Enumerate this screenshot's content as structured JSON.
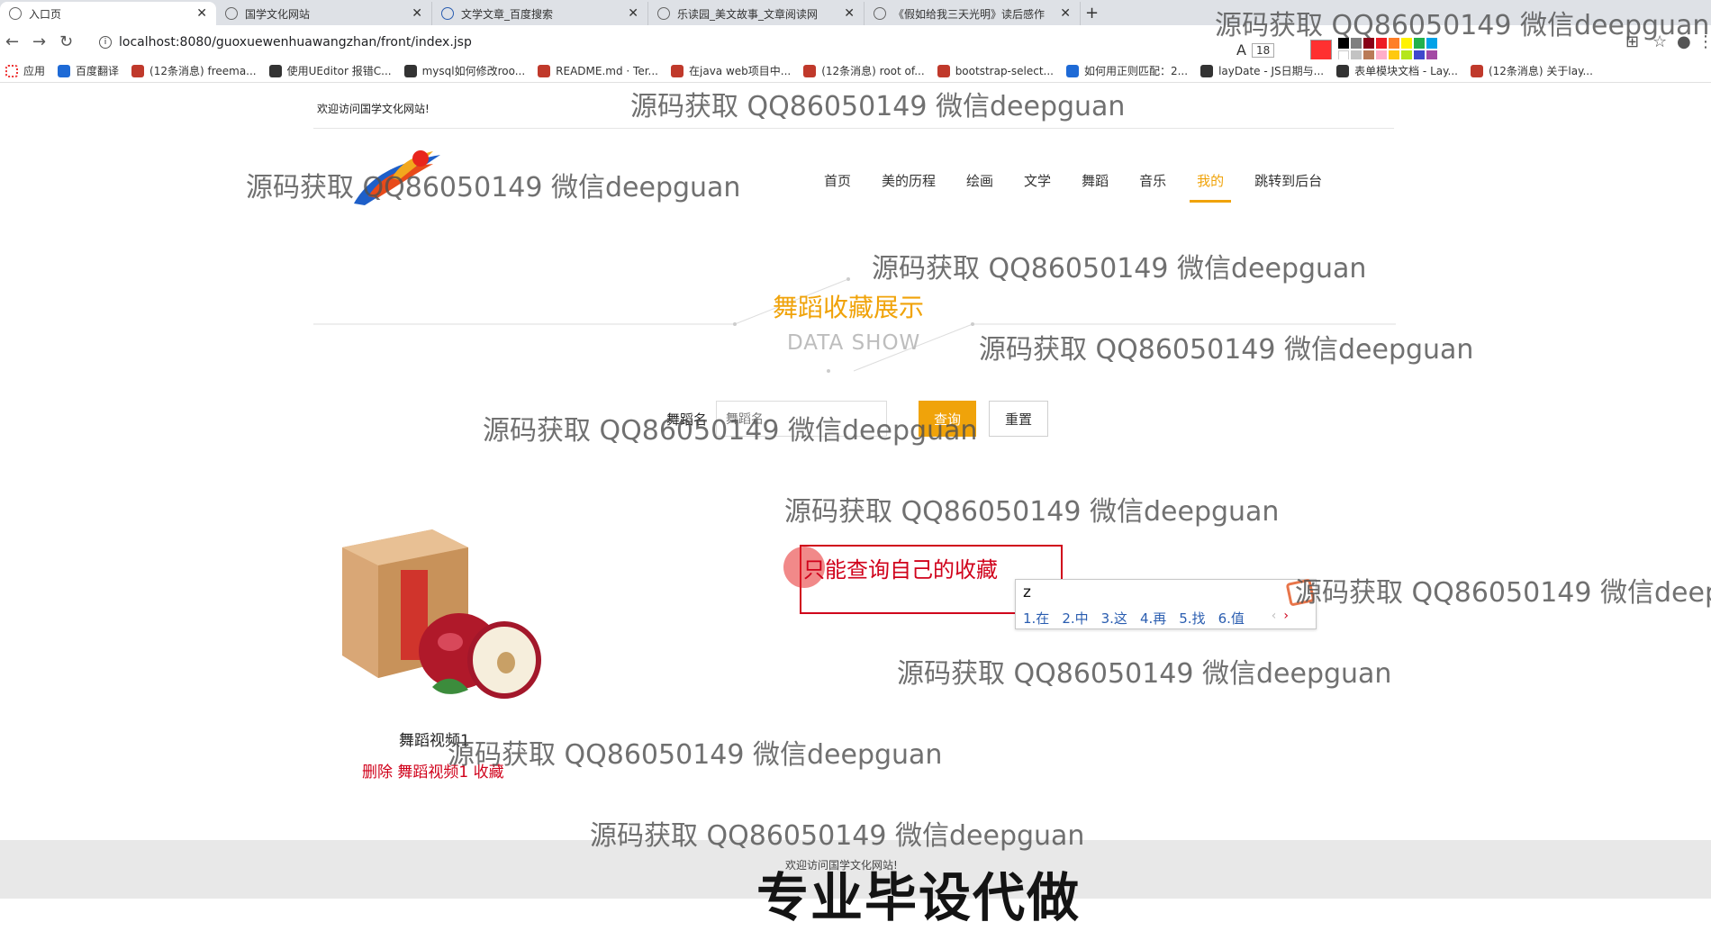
{
  "browser": {
    "tabs": [
      {
        "title": "入口页",
        "active": true
      },
      {
        "title": "国学文化网站",
        "active": false
      },
      {
        "title": "文学文章_百度搜索",
        "active": false
      },
      {
        "title": "乐读园_美文故事_文章阅读网",
        "active": false
      },
      {
        "title": "《假如给我三天光明》读后感作",
        "active": false
      }
    ],
    "url": "localhost:8080/guoxuewenhuawangzhan/front/index.jsp",
    "bookmarks": [
      "应用",
      "百度翻译",
      "(12条消息) freema...",
      "使用UEditor 报错C...",
      "mysql如何修改roo...",
      "README.md · Ter...",
      "在java web项目中...",
      "(12条消息) root of...",
      "bootstrap-select...",
      "如何用正则匹配：2...",
      "layDate - JS日期与...",
      "表单模块文档 - Lay...",
      "(12条消息) 关于lay..."
    ],
    "annotation_font_size": "18"
  },
  "page": {
    "welcome": "欢迎访问国学文化网站!",
    "nav": [
      {
        "label": "首页",
        "active": false
      },
      {
        "label": "美的历程",
        "active": false
      },
      {
        "label": "绘画",
        "active": false
      },
      {
        "label": "文学",
        "active": false
      },
      {
        "label": "舞蹈",
        "active": false
      },
      {
        "label": "音乐",
        "active": false
      },
      {
        "label": "我的",
        "active": true
      },
      {
        "label": "跳转到后台",
        "active": false
      }
    ],
    "section_title": "舞蹈收藏展示",
    "section_subtitle": "DATA SHOW",
    "search": {
      "label": "舞蹈名",
      "placeholder": "舞蹈名",
      "search_button": "查询",
      "reset_button": "重置"
    },
    "items": [
      {
        "title": "舞蹈视频1",
        "actions": "删除 舞蹈视频1 收藏"
      }
    ],
    "footer_text": "欢迎访问国学文化网站!"
  },
  "annotation": {
    "text": "只能查询自己的收藏"
  },
  "ime": {
    "input": "z",
    "candidates": [
      "1.在",
      "2.中",
      "3.这",
      "4.再",
      "5.找",
      "6.值"
    ]
  },
  "overlay": {
    "watermark": "源码获取 QQ86050149 微信deepguan",
    "banner": "专业毕设代做"
  },
  "colors": {
    "accent": "#f0a30a",
    "annotation_red": "#d0021b",
    "footer_bg": "#e8e8e8"
  }
}
